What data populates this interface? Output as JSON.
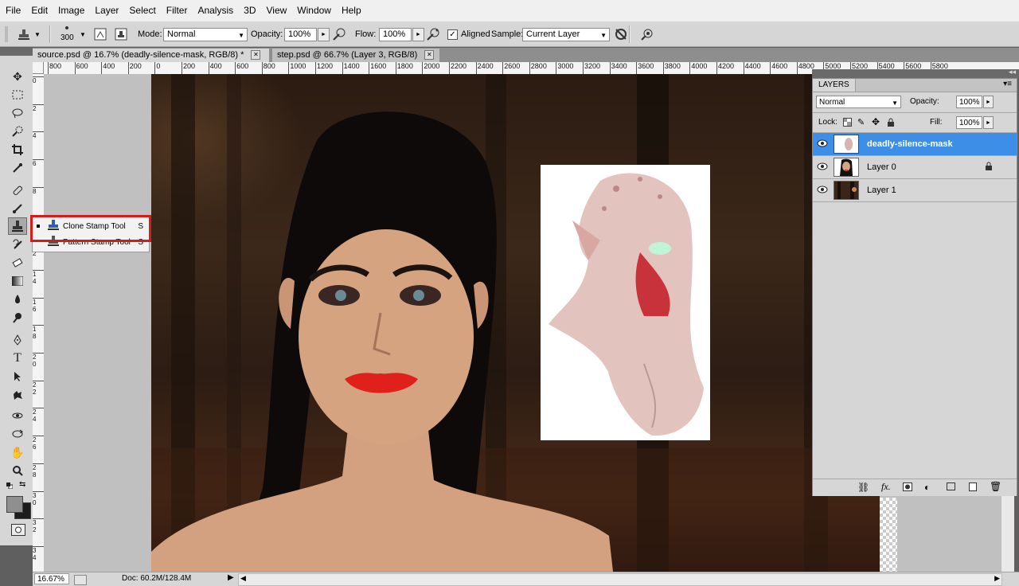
{
  "menu": [
    "File",
    "Edit",
    "Image",
    "Layer",
    "Select",
    "Filter",
    "Analysis",
    "3D",
    "View",
    "Window",
    "Help"
  ],
  "options": {
    "brush_size": "300",
    "mode_label": "Mode:",
    "mode_value": "Normal",
    "opacity_label": "Opacity:",
    "opacity_value": "100%",
    "flow_label": "Flow:",
    "flow_value": "100%",
    "aligned_label": "Aligned",
    "aligned_checked": true,
    "sample_label": "Sample:",
    "sample_value": "Current Layer"
  },
  "tabs": [
    {
      "label": "source.psd @ 16.7% (deadly-silence-mask, RGB/8) *",
      "active": true
    },
    {
      "label": "step.psd @ 66.7% (Layer 3, RGB/8)",
      "active": false
    }
  ],
  "hruler_labels": [
    "800",
    "600",
    "400",
    "200",
    "0",
    "200",
    "400",
    "600",
    "800",
    "1000",
    "1200",
    "1400",
    "1600",
    "1800",
    "2000",
    "2200",
    "2400",
    "2600",
    "2800",
    "3000",
    "3200",
    "3400",
    "3600",
    "3800",
    "4000",
    "4200",
    "4400",
    "4600",
    "4800",
    "5000",
    "5200",
    "5400",
    "5600",
    "5800"
  ],
  "vruler_labels": [
    "0",
    "2",
    "4",
    "6",
    "8",
    "1 0",
    "1 2",
    "1 4",
    "1 6",
    "1 8",
    "2 0",
    "2 2",
    "2 4",
    "2 6",
    "2 8",
    "3 0",
    "3 2",
    "3 4"
  ],
  "tool_flyout": [
    {
      "label": "Clone Stamp Tool",
      "shortcut": "S",
      "selected": true
    },
    {
      "label": "Pattern Stamp Tool",
      "shortcut": "S",
      "selected": false
    }
  ],
  "status": {
    "zoom": "16.67%",
    "doc": "Doc: 60.2M/128.4M"
  },
  "layers_panel": {
    "title": "LAYERS",
    "blend_mode": "Normal",
    "opacity_label": "Opacity:",
    "opacity_value": "100%",
    "lock_label": "Lock:",
    "fill_label": "Fill:",
    "fill_value": "100%",
    "layers": [
      {
        "name": "deadly-silence-mask",
        "selected": true,
        "locked": false
      },
      {
        "name": "Layer 0",
        "selected": false,
        "locked": true
      },
      {
        "name": "Layer 1",
        "selected": false,
        "locked": false
      }
    ]
  },
  "colors": {
    "accent": "#3d8ee6",
    "highlight": "#d61b1b",
    "lips": "#e0201b"
  }
}
